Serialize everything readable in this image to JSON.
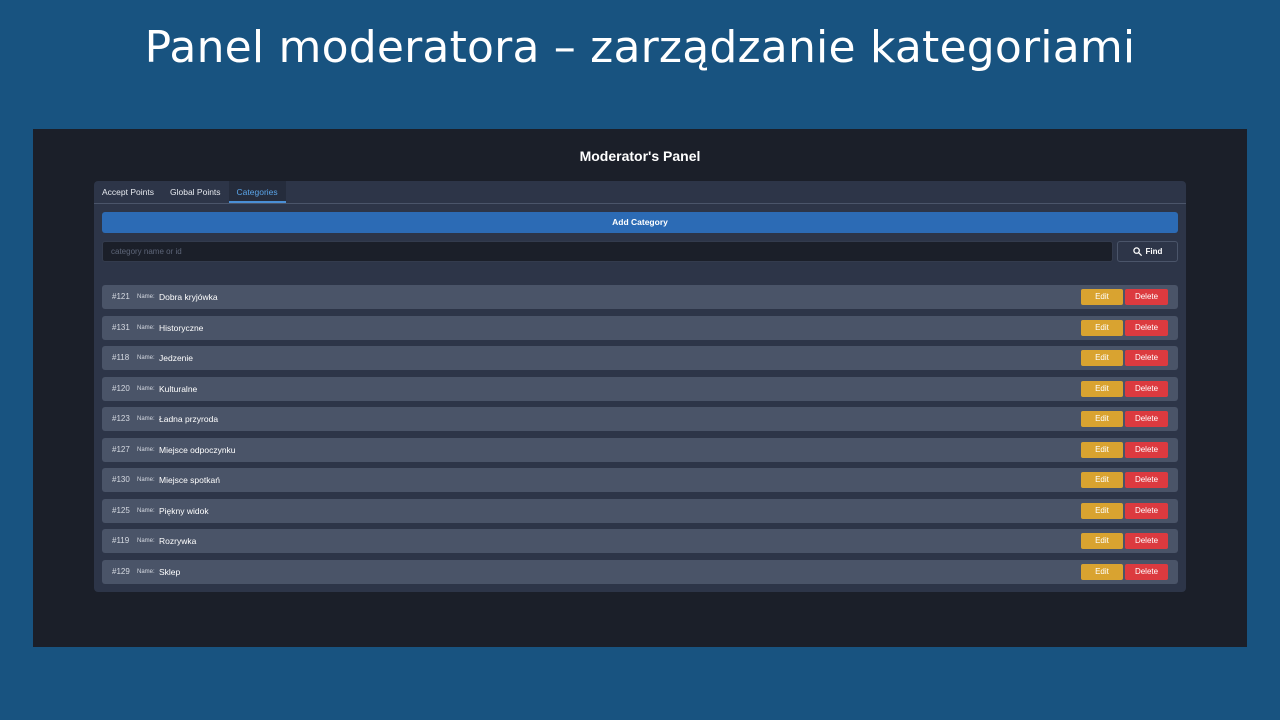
{
  "slide": {
    "title": "Panel moderatora – zarządzanie kategoriami"
  },
  "app": {
    "title": "Moderator's Panel",
    "tabs": [
      {
        "label": "Accept Points",
        "active": false
      },
      {
        "label": "Global Points",
        "active": false
      },
      {
        "label": "Categories",
        "active": true
      }
    ],
    "add_category_label": "Add Category",
    "search": {
      "placeholder": "category name or id",
      "value": ""
    },
    "find_label": "Find",
    "find_icon": "search-icon",
    "name_label": "Name:",
    "edit_label": "Edit",
    "delete_label": "Delete",
    "categories": [
      {
        "id": "#121",
        "name": "Dobra kryjówka"
      },
      {
        "id": "#131",
        "name": "Historyczne"
      },
      {
        "id": "#118",
        "name": "Jedzenie"
      },
      {
        "id": "#120",
        "name": "Kulturalne"
      },
      {
        "id": "#123",
        "name": "Ładna przyroda"
      },
      {
        "id": "#127",
        "name": "Miejsce odpoczynku"
      },
      {
        "id": "#130",
        "name": "Miejsce spotkań"
      },
      {
        "id": "#125",
        "name": "Piękny widok"
      },
      {
        "id": "#119",
        "name": "Rozrywka"
      },
      {
        "id": "#129",
        "name": "Sklep"
      }
    ]
  },
  "colors": {
    "slide_background": "#185380",
    "app_background": "#1b1f29",
    "panel_background": "#2d3548",
    "row_background": "#4a5468",
    "primary_button": "#2c6bb5",
    "edit_button": "#d9a330",
    "delete_button": "#dc3a3f",
    "active_tab": "#5aa4e8"
  }
}
